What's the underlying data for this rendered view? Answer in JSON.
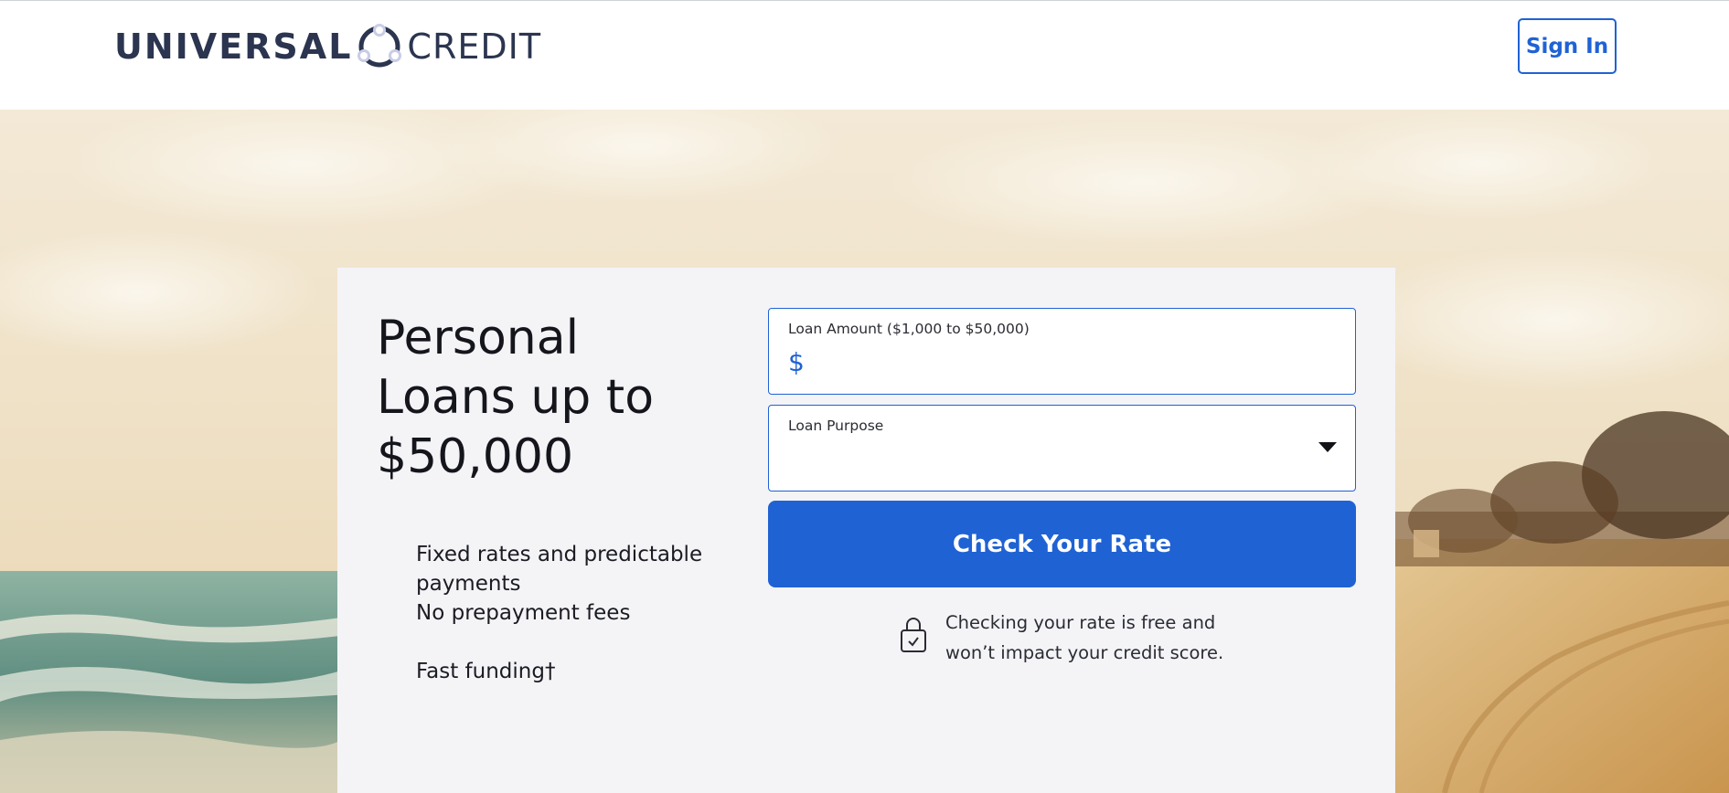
{
  "header": {
    "logo_left": "UNIVERSAL",
    "logo_right": "CREDIT",
    "sign_in_label": "Sign In"
  },
  "hero": {
    "headline": "Personal Loans up to $50,000",
    "features": [
      "Fixed rates and predictable payments",
      "No prepayment fees",
      "Fast funding†"
    ]
  },
  "form": {
    "loan_amount_label": "Loan Amount ($1,000 to $50,000)",
    "currency_symbol": "$",
    "loan_amount_value": "",
    "loan_purpose_label": "Loan Purpose",
    "loan_purpose_selected": "",
    "submit_label": "Check Your Rate",
    "disclaimer": "Checking your rate is free and won’t impact your credit score."
  },
  "colors": {
    "brand_blue": "#1f62d4",
    "logo_navy": "#2b3550",
    "card_bg": "#f4f4f7"
  },
  "icons": {
    "logo": "universal-credit-ring-logo",
    "dropdown": "caret-down-icon",
    "lock": "lock-check-icon"
  }
}
